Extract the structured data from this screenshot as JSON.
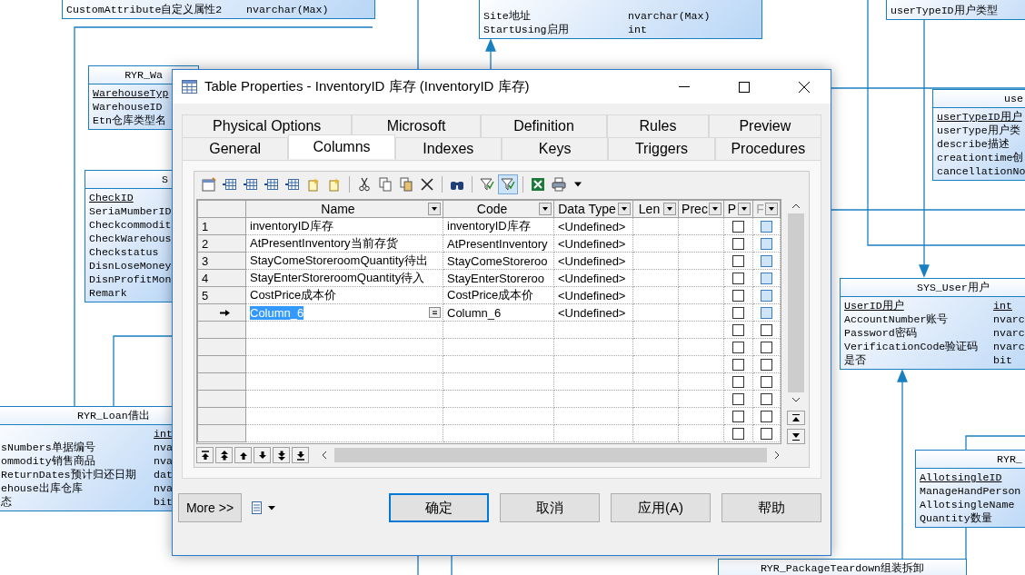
{
  "diagram": {
    "entities": [
      {
        "rows": [
          {
            "name": "CustomAttribute自定义属性2",
            "type": "nvarchar(Max)",
            "primary_key": false
          }
        ]
      },
      {
        "rows": [
          {
            "name": "Site地址",
            "type": "nvarchar(Max)",
            "primary_key": false
          },
          {
            "name": "StartUsing启用",
            "type": "int",
            "primary_key": false
          }
        ]
      },
      {
        "rows": [
          {
            "name": "userTypeID用户类型",
            "primary_key": false
          }
        ]
      },
      {
        "title": "RYR_Wa",
        "rows": [
          {
            "name": "WarehouseTyp",
            "primary_key": true
          },
          {
            "name": "WarehouseID",
            "primary_key": false
          },
          {
            "name": "Etn仓库类型名",
            "primary_key": false
          }
        ]
      },
      {
        "title": "S",
        "rows": [
          {
            "name": "CheckID",
            "primary_key": true
          },
          {
            "name": "SeriaMumberID",
            "primary_key": false
          },
          {
            "name": "Checkcommodit",
            "primary_key": false
          },
          {
            "name": "CheckWarehous",
            "primary_key": false
          },
          {
            "name": "Checkstatus",
            "primary_key": false
          },
          {
            "name": "DisnLoseMoney",
            "primary_key": false
          },
          {
            "name": "DisnProfitMon",
            "primary_key": false
          },
          {
            "name": "Remark",
            "primary_key": false
          }
        ]
      },
      {
        "title": "use",
        "rows": [
          {
            "name": "userTypeID用户",
            "primary_key": true
          },
          {
            "name": "userType用户类",
            "primary_key": false
          },
          {
            "name": "describe描述",
            "primary_key": false
          },
          {
            "name": "creationtime创",
            "primary_key": false
          },
          {
            "name": "cancellationNo",
            "primary_key": false
          }
        ]
      },
      {
        "title": "SYS_User用户",
        "rows": [
          {
            "name": "UserID用户",
            "type": "int",
            "primary_key": true
          },
          {
            "name": "AccountNumber账号",
            "type": "nvarc",
            "primary_key": false
          },
          {
            "name": "Password密码",
            "type": "nvarc",
            "primary_key": false
          },
          {
            "name": "VerificationCode验证码",
            "type": "nvarc",
            "primary_key": false
          },
          {
            "name": "是否",
            "type": "bit",
            "primary_key": false
          }
        ]
      },
      {
        "title": "RYR_Loan借出",
        "rows": [
          {
            "type": "int",
            "primary_key": true
          },
          {
            "name": "sNumbers单据编号",
            "type": "nva",
            "primary_key": false
          },
          {
            "name": "ommodity销售商品",
            "type": "nva",
            "primary_key": false
          },
          {
            "name": "ReturnDates预计归还日期",
            "type": "dat",
            "primary_key": false
          },
          {
            "name": "ehouse出库仓库",
            "type": "nva",
            "primary_key": false
          },
          {
            "name": "态",
            "type": "bit",
            "primary_key": false
          }
        ]
      },
      {
        "title": "RYR_",
        "rows": [
          {
            "name": "AllotsingleID",
            "primary_key": true
          },
          {
            "name": "ManageHandPerson",
            "primary_key": false
          },
          {
            "name": "AllotsingleName",
            "primary_key": false
          },
          {
            "name": "Quantity数量",
            "primary_key": false
          }
        ]
      },
      {
        "title": "RYR_PackageTeardown组装拆卸"
      }
    ]
  },
  "window": {
    "title": "Table Properties - InventoryID 库存 (InventoryID 库存)"
  },
  "tab_rows": [
    {
      "tabs": [
        {
          "label": "Physical Options",
          "selected": false
        },
        {
          "label": "Microsoft",
          "selected": false
        },
        {
          "label": "Definition",
          "selected": false
        },
        {
          "label": "Rules",
          "selected": false
        },
        {
          "label": "Preview",
          "selected": false
        }
      ]
    },
    {
      "tabs": [
        {
          "label": "General",
          "selected": false
        },
        {
          "label": "Columns",
          "selected": true
        },
        {
          "label": "Indexes",
          "selected": false
        },
        {
          "label": "Keys",
          "selected": false
        },
        {
          "label": "Triggers",
          "selected": false
        },
        {
          "label": "Procedures",
          "selected": false
        }
      ]
    }
  ],
  "grid": {
    "columns": [
      {
        "label": "Name",
        "disabled": false
      },
      {
        "label": "Code",
        "disabled": false
      },
      {
        "label": "Data Type",
        "disabled": false
      },
      {
        "label": "Len",
        "disabled": false
      },
      {
        "label": "Prec",
        "disabled": false
      },
      {
        "label": "P",
        "disabled": false
      },
      {
        "label": "F",
        "disabled": true
      }
    ],
    "rows": [
      {
        "number": "1",
        "current": false,
        "name": "inventoryID库存",
        "code": "inventoryID库存",
        "data_type": "<Undefined>",
        "primary": false,
        "foreign": false,
        "foreign_disabled": true
      },
      {
        "number": "2",
        "current": false,
        "name": "AtPresentInventory当前存货",
        "code": "AtPresentInventory",
        "data_type": "<Undefined>",
        "primary": false,
        "foreign": false,
        "foreign_disabled": true
      },
      {
        "number": "3",
        "current": false,
        "name": "StayComeStoreroomQuantity待出",
        "code": "StayComeStoreroo",
        "data_type": "<Undefined>",
        "primary": false,
        "foreign": false,
        "foreign_disabled": true
      },
      {
        "number": "4",
        "current": false,
        "name": "StayEnterStoreroomQuantity待入",
        "code": "StayEnterStoreroo",
        "data_type": "<Undefined>",
        "primary": false,
        "foreign": false,
        "foreign_disabled": true
      },
      {
        "number": "5",
        "current": false,
        "name": "CostPrice成本价",
        "code": "CostPrice成本价",
        "data_type": "<Undefined>",
        "primary": false,
        "foreign": false,
        "foreign_disabled": true
      },
      {
        "current": true,
        "name": "Column_6",
        "code": "Column_6",
        "data_type": "<Undefined>",
        "primary": false,
        "foreign": false,
        "foreign_disabled": true
      },
      {
        "current": false,
        "primary": false,
        "foreign": false,
        "foreign_disabled": false
      },
      {
        "current": false,
        "primary": false,
        "foreign": false,
        "foreign_disabled": false
      },
      {
        "current": false,
        "primary": false,
        "foreign": false,
        "foreign_disabled": false
      },
      {
        "current": false,
        "primary": false,
        "foreign": false,
        "foreign_disabled": false
      },
      {
        "current": false,
        "primary": false,
        "foreign": false,
        "foreign_disabled": false
      },
      {
        "current": false,
        "primary": false,
        "foreign": false,
        "foreign_disabled": false
      },
      {
        "current": false,
        "primary": false,
        "foreign": false,
        "foreign_disabled": false
      }
    ]
  },
  "more_button": "More >>",
  "buttons": [
    {
      "label": "确定",
      "default": true
    },
    {
      "label": "取消",
      "default": false
    },
    {
      "label": "应用(A)",
      "default": false
    },
    {
      "label": "帮助",
      "default": false
    }
  ]
}
